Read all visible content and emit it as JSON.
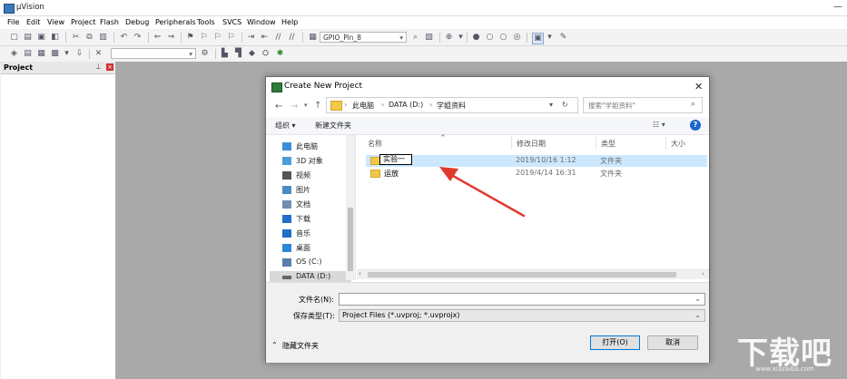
{
  "window": {
    "title": "µVision"
  },
  "menu": [
    "File",
    "Edit",
    "View",
    "Project",
    "Flash",
    "Debug",
    "Peripherals",
    "Tools",
    "SVCS",
    "Window",
    "Help"
  ],
  "toolbar": {
    "target_combo": "GPIO_Pin_8"
  },
  "project_panel": {
    "title": "Project"
  },
  "dialog": {
    "title": "Create New Project",
    "breadcrumb": [
      "此电脑",
      "DATA (D:)",
      "学姐资料"
    ],
    "search_placeholder": "搜索\"学姐资料\"",
    "commands": {
      "organize": "组织 ▾",
      "new_folder": "新建文件夹"
    },
    "nav_items": [
      {
        "label": "此电脑",
        "color": "#3b8fd9"
      },
      {
        "label": "3D 对象",
        "color": "#4a9ed6"
      },
      {
        "label": "视频",
        "color": "#555555"
      },
      {
        "label": "图片",
        "color": "#4a8bc4"
      },
      {
        "label": "文档",
        "color": "#6f8fb3"
      },
      {
        "label": "下载",
        "color": "#1f6fc8"
      },
      {
        "label": "音乐",
        "color": "#1f6fc8"
      },
      {
        "label": "桌面",
        "color": "#2f86d6"
      },
      {
        "label": "OS (C:)",
        "color": "#5a7fa8"
      },
      {
        "label": "DATA (D:)",
        "color": "#666666"
      }
    ],
    "columns": {
      "name": "名称",
      "date": "修改日期",
      "type": "类型",
      "size": "大小"
    },
    "files": [
      {
        "name": "实验一",
        "date": "2019/10/16 1:12",
        "type": "文件夹"
      },
      {
        "name": "运放",
        "date": "2019/4/14 16:31",
        "type": "文件夹"
      }
    ],
    "filename_label": "文件名(N):",
    "filename_value": "",
    "filetype_label": "保存类型(T):",
    "filetype_value": "Project Files (*.uvproj; *.uvprojx)",
    "hide_folders": "隐藏文件夹",
    "open_button": "打开(O)",
    "cancel_button": "取消"
  },
  "watermark": {
    "main": "下载吧",
    "sub": "www.xiazaiba.com"
  },
  "colors": {
    "accent": "#0078d7",
    "arrow": "#e03a2f",
    "workspace": "#a9a9a9"
  }
}
